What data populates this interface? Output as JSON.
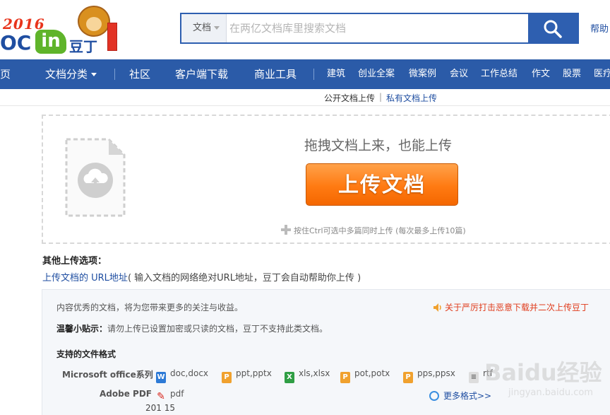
{
  "header": {
    "logo": {
      "year": "2016",
      "brand_left": "OC",
      "brand_in": "in",
      "brand_cn": "豆丁"
    },
    "search": {
      "scope": "文档",
      "placeholder": "在两亿文档库里搜索文档"
    },
    "help": "帮助"
  },
  "nav": {
    "main": [
      {
        "label": "页"
      },
      {
        "label": "文档分类"
      },
      {
        "label": "社区"
      },
      {
        "label": "客户端下载"
      },
      {
        "label": "商业工具"
      }
    ],
    "tags": [
      "建筑",
      "创业全案",
      "微案例",
      "会议",
      "工作总结",
      "作文",
      "股票",
      "医疗"
    ]
  },
  "subtabs": {
    "public": "公开文档上传",
    "separator": "|",
    "private": "私有文档上传"
  },
  "upload": {
    "drag_hint": "拖拽文档上来，也能上传",
    "button": "上传文档",
    "ctrl_tip": "按住Ctrl可选中多篇同时上传 (每次最多上传10篇)"
  },
  "other": {
    "title": "其他上传选项：",
    "url_link": "上传文档的 URL地址",
    "url_desc": "( 输入文档的网络绝对URL地址，豆丁会自动帮助你上传 )"
  },
  "info": {
    "line1": "内容优秀的文档，将为您带来更多的关注与收益。",
    "notice": "关于严厉打击恶意下载并二次上传豆丁",
    "tip_label": "温馨小贴示：",
    "tip_text": "请勿上传已设置加密或只读的文档，豆丁不支持此类文档。",
    "formats_title": "支持的文件格式",
    "rows": [
      {
        "label": "Microsoft office系列",
        "items": [
          {
            "icon": "word-icon",
            "glyph": "W",
            "kind": "word",
            "text": "doc,docx"
          },
          {
            "icon": "ppt-icon",
            "glyph": "P",
            "kind": "ppt",
            "text": "ppt,pptx"
          },
          {
            "icon": "excel-icon",
            "glyph": "X",
            "kind": "xls",
            "text": "xls,xlsx"
          },
          {
            "icon": "pot-icon",
            "glyph": "P",
            "kind": "ppt",
            "text": "pot,potx"
          },
          {
            "icon": "pps-icon",
            "glyph": "P",
            "kind": "ppt",
            "text": "pps,ppsx"
          },
          {
            "icon": "rtf-icon",
            "glyph": "≡",
            "kind": "txt",
            "text": "rtf"
          }
        ]
      },
      {
        "label": "Adobe PDF",
        "items": [
          {
            "icon": "pdf-icon",
            "glyph": "✎",
            "kind": "pdf",
            "text": "pdf"
          }
        ]
      }
    ],
    "more_formats": "更多格式>>",
    "cut_row": "201 15"
  },
  "watermark": {
    "main": "Baidu经验",
    "sub": "jingyan.baidu.com"
  },
  "colors": {
    "nav_blue": "#2b5ba8",
    "upload_orange": "#ff7a12",
    "link_blue": "#1f4ea1",
    "notice_red": "#e03c1c"
  }
}
